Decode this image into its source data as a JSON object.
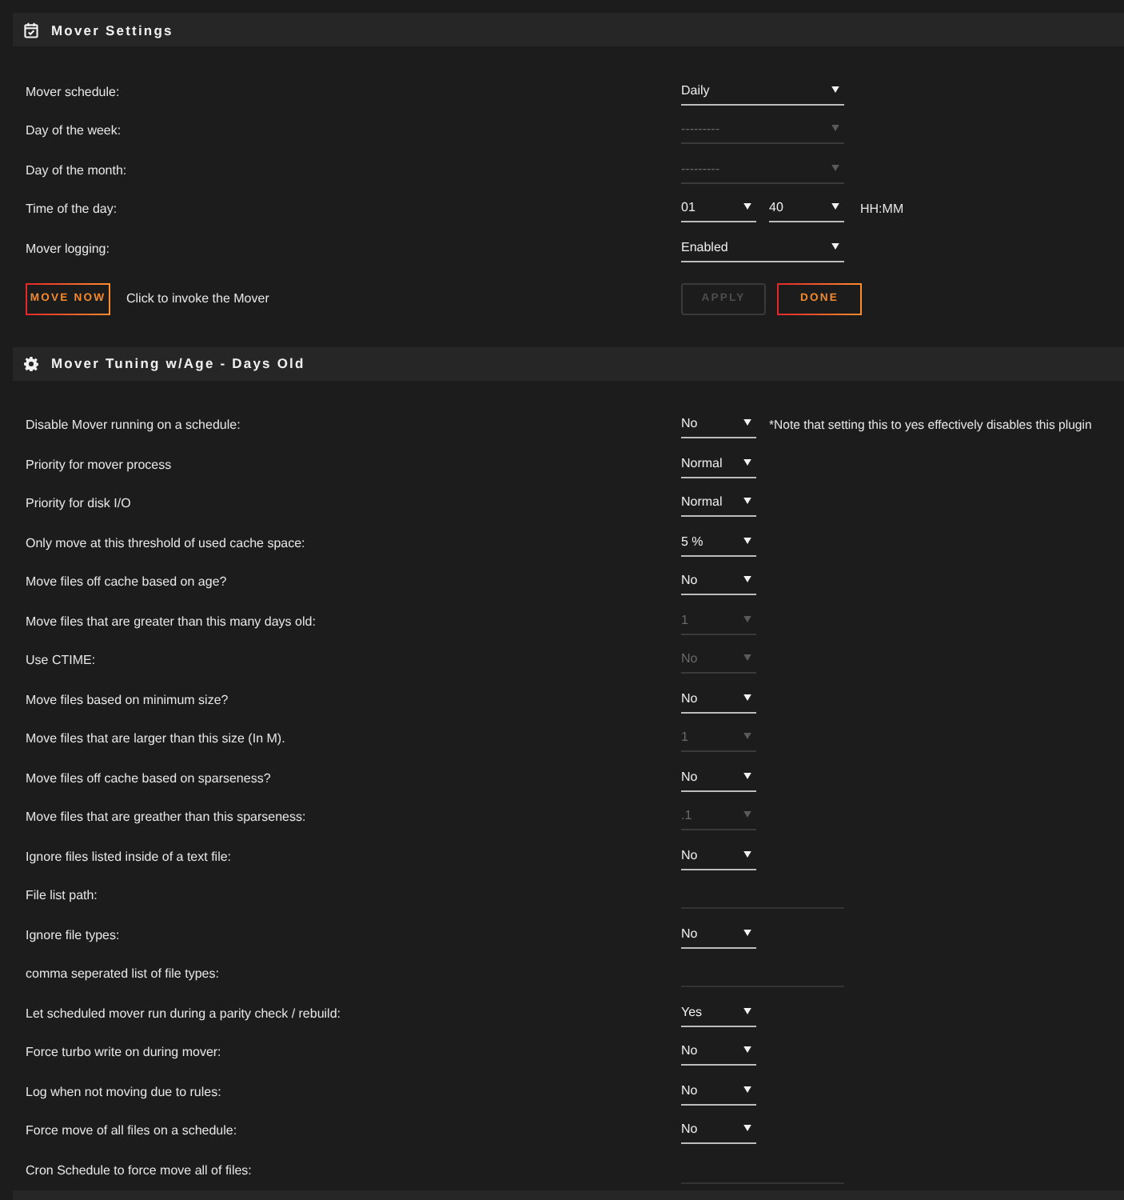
{
  "sections": [
    {
      "title": "Mover Settings",
      "rows": [
        {
          "kind": "select",
          "label": "Mover schedule:",
          "value": "Daily",
          "disabled": false
        },
        {
          "kind": "select",
          "label": "Day of the week:",
          "value": "---------",
          "disabled": true
        },
        {
          "kind": "select",
          "label": "Day of the month:",
          "value": "---------",
          "disabled": true
        },
        {
          "kind": "time",
          "label": "Time of the day:",
          "hour": "01",
          "minute": "40",
          "suffix": "HH:MM"
        },
        {
          "kind": "select",
          "label": "Mover logging:",
          "value": "Enabled",
          "disabled": false
        }
      ],
      "actions": {
        "move_now": "MOVE NOW",
        "hint": "Click to invoke the Mover",
        "apply": {
          "label": "APPLY",
          "disabled": true
        },
        "done": "DONE"
      }
    },
    {
      "title": "Mover Tuning w/Age - Days Old",
      "rows": [
        {
          "kind": "select",
          "label": "Disable Mover running on a schedule:",
          "value": "No",
          "disabled": false,
          "note": "*Note that setting this to yes effectively disables this plugin"
        },
        {
          "kind": "select",
          "label": "Priority for mover process",
          "value": "Normal",
          "disabled": false
        },
        {
          "kind": "select",
          "label": "Priority for disk I/O",
          "value": "Normal",
          "disabled": false
        },
        {
          "kind": "select",
          "label": "Only move at this threshold of used cache space:",
          "value": "5 %",
          "disabled": false
        },
        {
          "kind": "select",
          "label": "Move files off cache based on age?",
          "value": "No",
          "disabled": false
        },
        {
          "kind": "select",
          "label": "Move files that are greater than this many days old:",
          "value": "1",
          "disabled": true
        },
        {
          "kind": "select",
          "label": "Use CTIME:",
          "value": "No",
          "disabled": true
        },
        {
          "kind": "select",
          "label": "Move files based on minimum size?",
          "value": "No",
          "disabled": false
        },
        {
          "kind": "select",
          "label": "Move files that are larger than this size (In M).",
          "value": "1",
          "disabled": true
        },
        {
          "kind": "select",
          "label": "Move files off cache based on sparseness?",
          "value": "No",
          "disabled": false
        },
        {
          "kind": "select",
          "label": "Move files that are greather than this sparseness:",
          "value": ".1",
          "disabled": true
        },
        {
          "kind": "select",
          "label": "Ignore files listed inside of a text file:",
          "value": "No",
          "disabled": false
        },
        {
          "kind": "text",
          "label": "File list path:",
          "disabled": true
        },
        {
          "kind": "select",
          "label": "Ignore file types:",
          "value": "No",
          "disabled": false
        },
        {
          "kind": "text",
          "label": "comma seperated list of file types:",
          "disabled": true
        },
        {
          "kind": "select",
          "label": "Let scheduled mover run during a parity check / rebuild:",
          "value": "Yes",
          "disabled": false
        },
        {
          "kind": "select",
          "label": "Force turbo write on during mover:",
          "value": "No",
          "disabled": false
        },
        {
          "kind": "select",
          "label": "Log when not moving due to rules:",
          "value": "No",
          "disabled": false
        },
        {
          "kind": "select",
          "label": "Force move of all files on a schedule:",
          "value": "No",
          "disabled": false
        },
        {
          "kind": "text",
          "label": "Cron Schedule to force move all of files:",
          "disabled": true
        }
      ]
    }
  ]
}
